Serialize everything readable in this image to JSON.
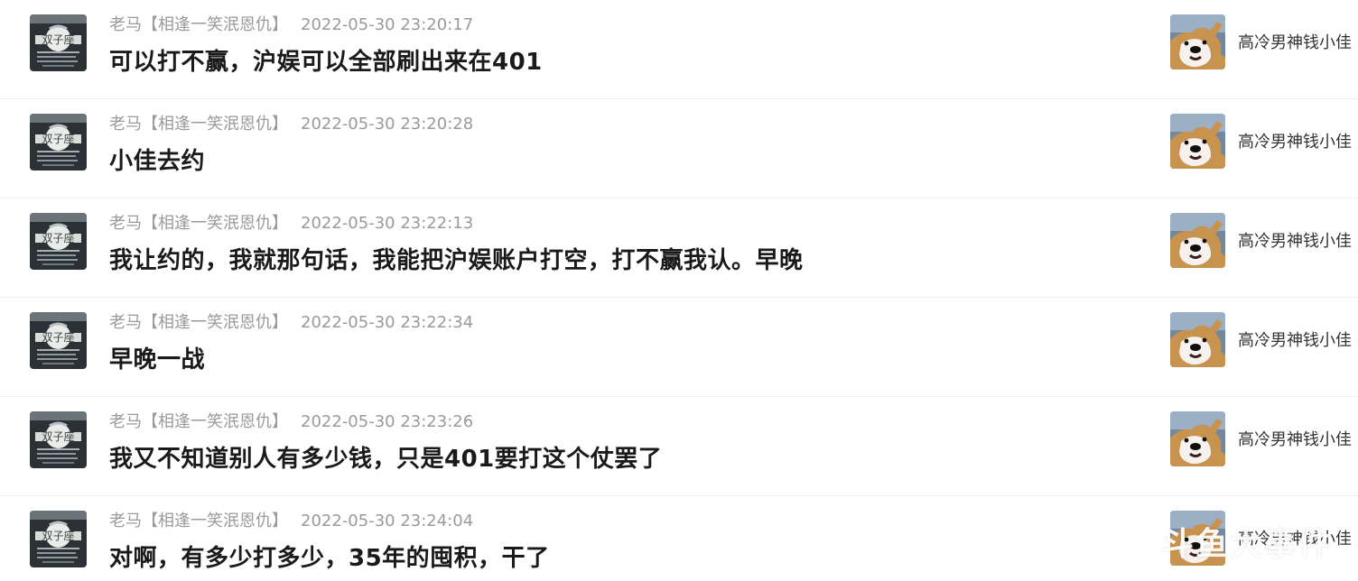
{
  "messages": [
    {
      "author": "老马【相逢一笑泯恩仇】",
      "time": "2022-05-30 23:20:17",
      "text": "可以打不赢，沪娱可以全部刷出来在401",
      "right_user": "高冷男神钱小佳"
    },
    {
      "author": "老马【相逢一笑泯恩仇】",
      "time": "2022-05-30 23:20:28",
      "text": "小佳去约",
      "right_user": "高冷男神钱小佳"
    },
    {
      "author": "老马【相逢一笑泯恩仇】",
      "time": "2022-05-30 23:22:13",
      "text": "我让约的，我就那句话，我能把沪娱账户打空，打不赢我认。早晚",
      "right_user": "高冷男神钱小佳"
    },
    {
      "author": "老马【相逢一笑泯恩仇】",
      "time": "2022-05-30 23:22:34",
      "text": "早晚一战",
      "right_user": "高冷男神钱小佳"
    },
    {
      "author": "老马【相逢一笑泯恩仇】",
      "time": "2022-05-30 23:23:26",
      "text": "我又不知道别人有多少钱，只是401要打这个仗罢了",
      "right_user": "高冷男神钱小佳"
    },
    {
      "author": "老马【相逢一笑泯恩仇】",
      "time": "2022-05-30 23:24:04",
      "text": "对啊，有多少打多少，35年的囤积，干了",
      "right_user": "高冷男神钱小佳"
    }
  ],
  "watermark": "斗鱼大事件",
  "avatar_left_text": "双子座",
  "colors": {
    "meta_text": "#9a9a9a",
    "message_text": "#1a1a1a",
    "divider": "#eeeeee",
    "right_name_text": "#333333"
  },
  "icons": {
    "left_avatar": "zodiac-gemini-avatar",
    "right_avatar": "shiba-dog-avatar"
  }
}
